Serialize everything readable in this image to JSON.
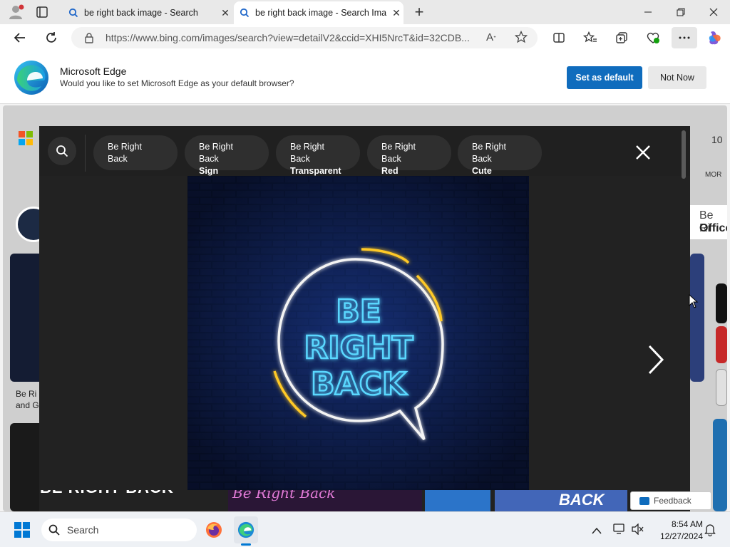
{
  "tabs": [
    {
      "label": "be right back image - Search",
      "icon": "search-icon"
    },
    {
      "label": "be right back image - Search Ima",
      "icon": "search-icon"
    }
  ],
  "address": {
    "url": "https://www.bing.com/images/search?view=detailV2&ccid=XHI5NrcT&id=32CDB..."
  },
  "infobar": {
    "title": "Microsoft Edge",
    "message": "Would you like to set Microsoft Edge as your default browser?",
    "primary_label": "Set as default",
    "secondary_label": "Not Now"
  },
  "background_page": {
    "tile_text_1": "Be Ri",
    "tile_text_2": "and G",
    "right_text_1": "Be Ri",
    "right_text_2": "Office",
    "right_count": "10",
    "right_more": "MOR",
    "bottom_text_1": "BE RIGHT BACK",
    "bottom_text_2": "Be Right Back",
    "bottom_text_3": "BACK",
    "feedback_label": "Feedback"
  },
  "modal": {
    "chips": [
      {
        "line1": "Be Right Back",
        "line2": ""
      },
      {
        "line1": "Be Right Back",
        "line2": "Sign"
      },
      {
        "line1": "Be Right Back",
        "line2": "Transparent"
      },
      {
        "line1": "Be Right Back",
        "line2": "Red"
      },
      {
        "line1": "Be Right Back",
        "line2": "Cute"
      }
    ],
    "neon_lines": [
      "BE",
      "RIGHT",
      "BACK"
    ]
  },
  "taskbar": {
    "search_placeholder": "Search",
    "time": "8:54 AM",
    "date": "12/27/2024"
  },
  "colors": {
    "accent": "#0f6cbd",
    "neon_text": "#5ad8ff",
    "neon_ring": "#f4f4f4",
    "neon_accent": "#ffc926",
    "brick_wall": "#0b1b48"
  }
}
